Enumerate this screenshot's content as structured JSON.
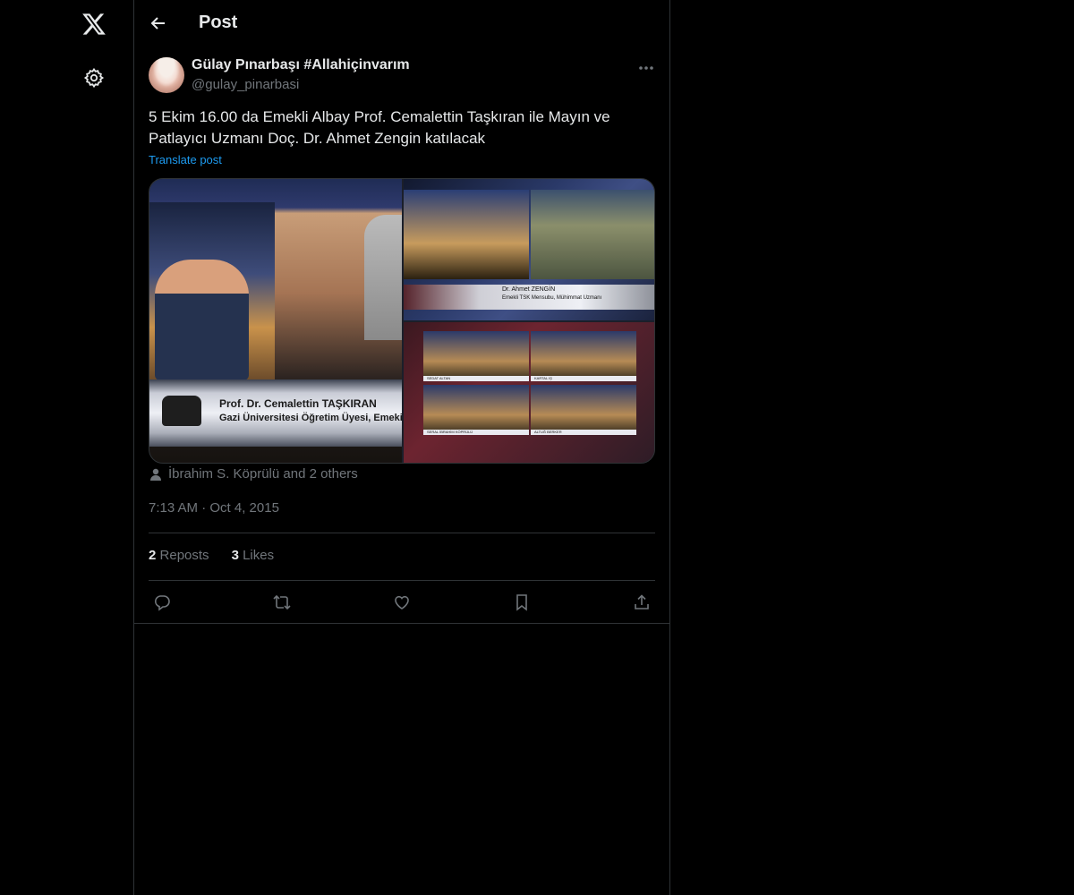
{
  "nav": {
    "logo_icon": "x-logo-icon",
    "settings_icon": "gear-icon"
  },
  "header": {
    "title": "Post",
    "back_icon": "arrow-left-icon"
  },
  "post": {
    "author_name": "Gülay Pınarbaşı #Allahiçinvarım",
    "author_handle": "@gulay_pinarbasi",
    "text": "5 Ekim 16.00 da Emekli Albay Prof. Cemalettin Taşkıran ile Mayın ve Patlayıcı Uzmanı Doç. Dr. Ahmet Zengin katılacak",
    "translate_label": "Translate post",
    "media": {
      "lower_third_name": "Prof. Dr. Cemalettin TAŞKIRAN",
      "lower_third_subtitle": "Gazi Üniversitesi Öğretim Üyesi, Emeki Al",
      "top_right_name": "Dr. Ahmet ZENGİN",
      "top_right_subtitle": "Emekli TSK Mensubu, Mühimmat Uzmanı",
      "grid_labels": [
        "SEDAT ALTAN",
        "KARTAL IŞ",
        "SERAL İBRAHİM KÖPRÜLÜ",
        "ALTUĞ BERKER"
      ]
    },
    "likers": "İbrahim S. Köprülü and 2 others",
    "timestamp": "7:13 AM · Oct 4, 2015",
    "reposts_count": "2",
    "reposts_label": "Reposts",
    "likes_count": "3",
    "likes_label": "Likes"
  },
  "colors": {
    "background": "#000000",
    "text_primary": "#e7e9ea",
    "text_secondary": "#71767b",
    "accent": "#1d9bf0",
    "border": "#2f3336"
  }
}
